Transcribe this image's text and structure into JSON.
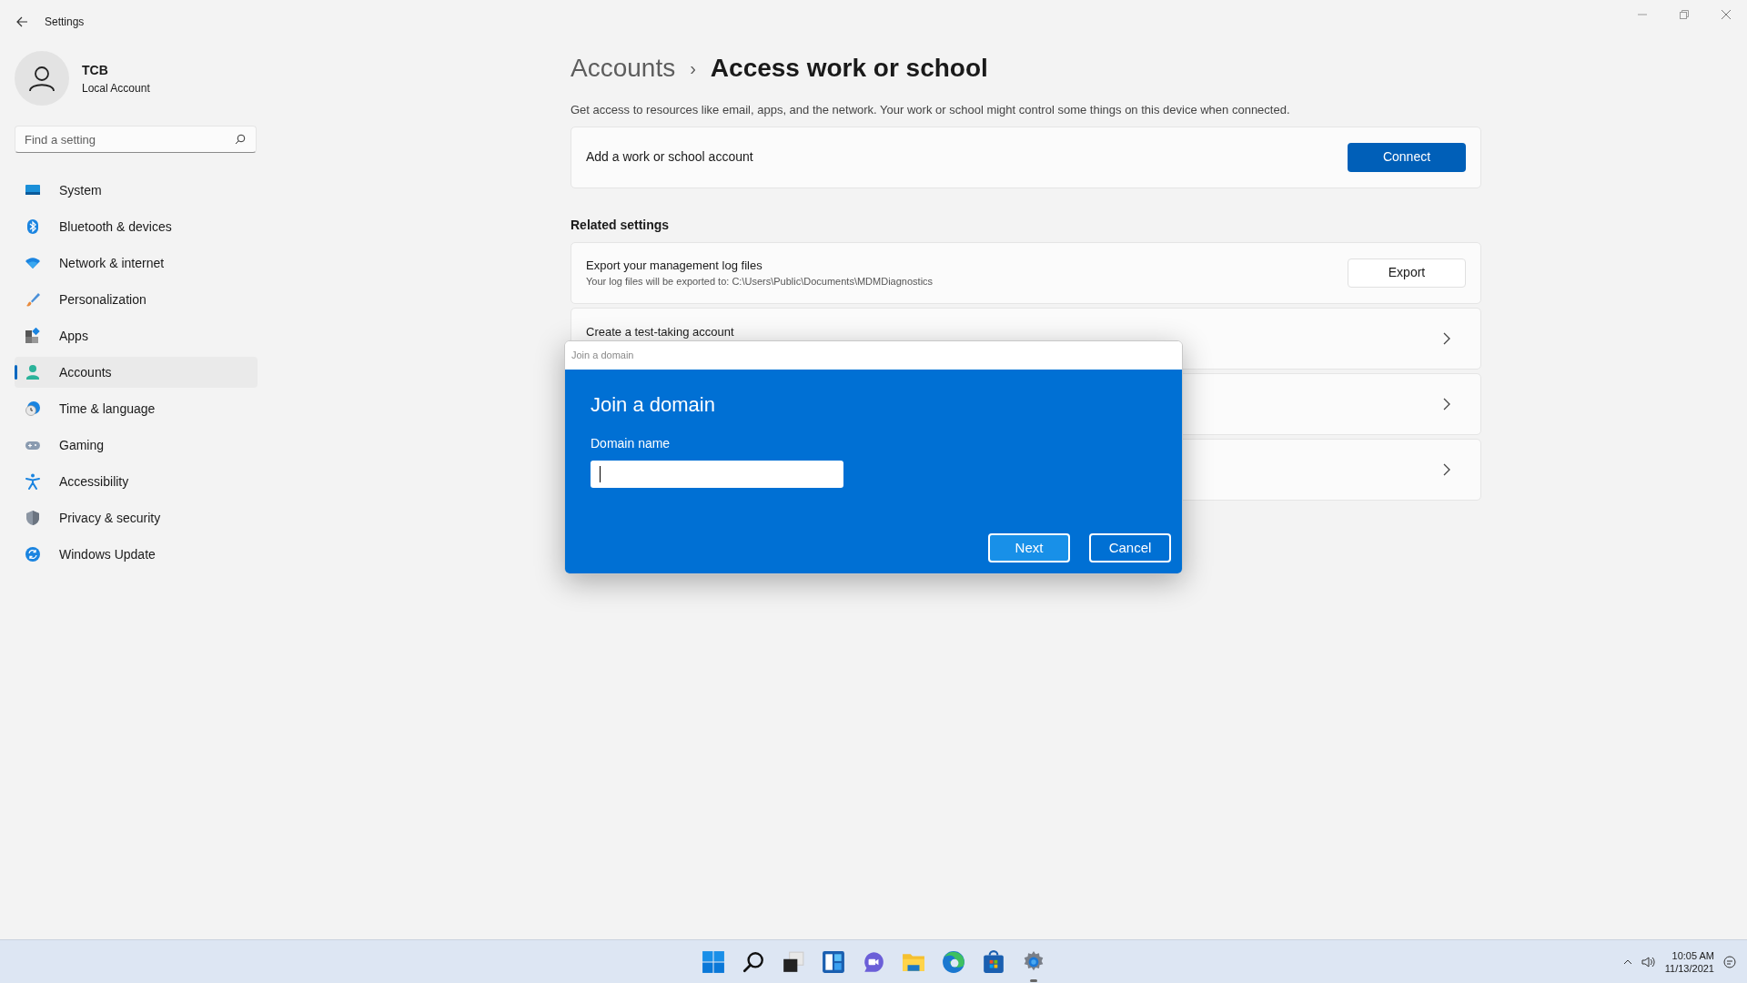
{
  "window": {
    "title": "Settings"
  },
  "profile": {
    "name": "TCB",
    "account_type": "Local Account"
  },
  "search": {
    "placeholder": "Find a setting"
  },
  "nav": [
    {
      "label": "System",
      "kind": "system",
      "selected": false
    },
    {
      "label": "Bluetooth & devices",
      "kind": "bluetooth",
      "selected": false
    },
    {
      "label": "Network & internet",
      "kind": "network",
      "selected": false
    },
    {
      "label": "Personalization",
      "kind": "brush",
      "selected": false
    },
    {
      "label": "Apps",
      "kind": "apps",
      "selected": false
    },
    {
      "label": "Accounts",
      "kind": "accounts",
      "selected": true
    },
    {
      "label": "Time & language",
      "kind": "time",
      "selected": false
    },
    {
      "label": "Gaming",
      "kind": "gaming",
      "selected": false
    },
    {
      "label": "Accessibility",
      "kind": "accessibility",
      "selected": false
    },
    {
      "label": "Privacy & security",
      "kind": "privacy",
      "selected": false
    },
    {
      "label": "Windows Update",
      "kind": "update",
      "selected": false
    }
  ],
  "breadcrumb": {
    "parent": "Accounts",
    "separator": "›",
    "current": "Access work or school"
  },
  "description": "Get access to resources like email, apps, and the network. Your work or school might control some things on this device when connected.",
  "connect_card": {
    "label": "Add a work or school account",
    "button": "Connect"
  },
  "related": {
    "heading": "Related settings",
    "cards": [
      {
        "kind": "button",
        "title": "Export your management log files",
        "subtitle": "Your log files will be exported to: C:\\Users\\Public\\Documents\\MDMDiagnostics",
        "button": "Export"
      },
      {
        "kind": "link",
        "title": "Create a test-taking account"
      },
      {
        "kind": "link"
      },
      {
        "kind": "link"
      }
    ]
  },
  "dialog": {
    "window_title": "Join a domain",
    "heading": "Join a domain",
    "field_label": "Domain name",
    "buttons": [
      {
        "label": "Next",
        "kind": "primary"
      },
      {
        "label": "Cancel",
        "kind": "secondary"
      }
    ]
  },
  "taskbar": {
    "apps": [
      {
        "kind": "start",
        "active": false
      },
      {
        "kind": "search",
        "active": false
      },
      {
        "kind": "taskview",
        "active": false
      },
      {
        "kind": "widgets",
        "active": false
      },
      {
        "kind": "chat",
        "active": false
      },
      {
        "kind": "explorer",
        "active": false
      },
      {
        "kind": "edge",
        "active": false
      },
      {
        "kind": "store",
        "active": false
      },
      {
        "kind": "settings",
        "active": true
      }
    ],
    "time": "10:05 AM",
    "date": "11/13/2021"
  }
}
